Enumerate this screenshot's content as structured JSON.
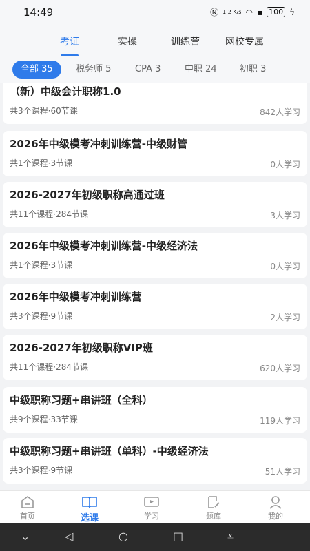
{
  "status": {
    "time": "14:49",
    "net": "1.2 K/s",
    "battery": "100"
  },
  "nav": {
    "tabs": [
      "考证",
      "实操",
      "训练营",
      "网校专属"
    ]
  },
  "filters": [
    "全部 35",
    "税务师 5",
    "CPA 3",
    "中职 24",
    "初职 3"
  ],
  "courses": [
    {
      "title": "（新）中级会计职称1.0",
      "meta": "共3个课程·60节课",
      "learners": "842人学习"
    },
    {
      "title": "2026年中级模考冲刺训练营-中级财管",
      "meta": "共1个课程·3节课",
      "learners": "0人学习"
    },
    {
      "title": "2026-2027年初级职称高通过班",
      "meta": "共11个课程·284节课",
      "learners": "3人学习"
    },
    {
      "title": "2026年中级模考冲刺训练营-中级经济法",
      "meta": "共1个课程·3节课",
      "learners": "0人学习"
    },
    {
      "title": "2026年中级模考冲刺训练营",
      "meta": "共3个课程·9节课",
      "learners": "2人学习"
    },
    {
      "title": "2026-2027年初级职称VIP班",
      "meta": "共11个课程·284节课",
      "learners": "620人学习"
    },
    {
      "title": "中级职称习题+串讲班（全科）",
      "meta": "共9个课程·33节课",
      "learners": "119人学习"
    },
    {
      "title": "中级职称习题+串讲班（单科）-中级经济法",
      "meta": "共3个课程·9节课",
      "learners": "51人学习"
    }
  ],
  "tabbar": [
    "首页",
    "选课",
    "学习",
    "题库",
    "我的"
  ],
  "colors": {
    "accent": "#2f7bea"
  }
}
